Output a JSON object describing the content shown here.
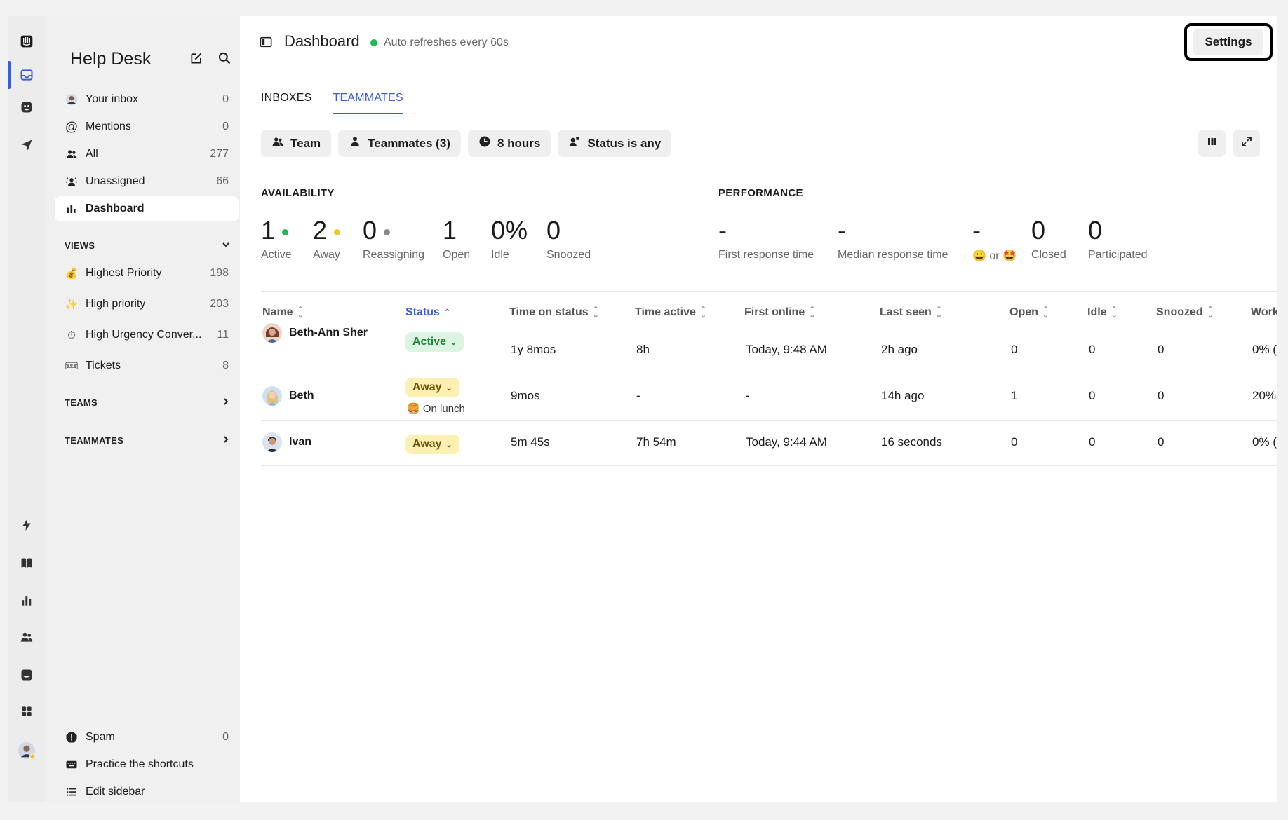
{
  "sidebar": {
    "title": "Help Desk",
    "items": [
      {
        "label": "Your inbox",
        "count": "0",
        "icon": "avatar-icon"
      },
      {
        "label": "Mentions",
        "count": "0",
        "icon": "at-icon"
      },
      {
        "label": "All",
        "count": "277",
        "icon": "people-icon"
      },
      {
        "label": "Unassigned",
        "count": "66",
        "icon": "unassigned-icon"
      },
      {
        "label": "Dashboard",
        "count": "",
        "icon": "bar-chart-icon"
      }
    ],
    "views_label": "VIEWS",
    "views": [
      {
        "label": "Highest Priority",
        "count": "198",
        "emoji": "💰"
      },
      {
        "label": "High priority",
        "count": "203",
        "emoji": "✨"
      },
      {
        "label": "High Urgency Conver...",
        "count": "11",
        "emoji": "⏱"
      },
      {
        "label": "Tickets",
        "count": "8",
        "emoji": "🎟"
      }
    ],
    "teams_label": "TEAMS",
    "teammates_label": "TEAMMATES",
    "bottom": [
      {
        "label": "Spam",
        "count": "0"
      },
      {
        "label": "Practice the shortcuts",
        "count": ""
      },
      {
        "label": "Edit sidebar",
        "count": ""
      }
    ]
  },
  "header": {
    "title": "Dashboard",
    "subtitle": "Auto refreshes every 60s",
    "settings_label": "Settings",
    "status_color": "#1db954"
  },
  "tabs": [
    {
      "label": "INBOXES",
      "active": false
    },
    {
      "label": "TEAMMATES",
      "active": true
    }
  ],
  "filters": [
    {
      "label": "Team",
      "icon": "team-icon"
    },
    {
      "label": "Teammates (3)",
      "icon": "person-icon"
    },
    {
      "label": "8 hours",
      "icon": "clock-icon"
    },
    {
      "label": "Status is any",
      "icon": "status-icon"
    }
  ],
  "availability": {
    "label": "AVAILABILITY",
    "stats": [
      {
        "value": "1",
        "label": "Active",
        "dot": "#1db954"
      },
      {
        "value": "2",
        "label": "Away",
        "dot": "#f5c518"
      },
      {
        "value": "0",
        "label": "Reassigning",
        "dot": "#888888"
      },
      {
        "value": "1",
        "label": "Open",
        "dot": ""
      },
      {
        "value": "0%",
        "label": "Idle",
        "dot": ""
      },
      {
        "value": "0",
        "label": "Snoozed",
        "dot": ""
      }
    ]
  },
  "performance": {
    "label": "PERFORMANCE",
    "stats": [
      {
        "value": "-",
        "label": "First response time"
      },
      {
        "value": "-",
        "label": "Median response time"
      },
      {
        "value": "-",
        "label": "😀 or 🤩"
      },
      {
        "value": "0",
        "label": "Closed"
      },
      {
        "value": "0",
        "label": "Participated"
      }
    ]
  },
  "table": {
    "columns": [
      "Name",
      "Status",
      "Time on status",
      "Time active",
      "First online",
      "Last seen",
      "Open",
      "Idle",
      "Snoozed",
      "Work"
    ],
    "rows": [
      {
        "name": "Beth-Ann Sher",
        "status": "Active",
        "note": "",
        "time_on_status": "1y 8mos",
        "time_active": "8h",
        "first_online": "Today, 9:48 AM",
        "last_seen": "2h ago",
        "open": "0",
        "idle": "0",
        "snoozed": "0",
        "work": "0% ("
      },
      {
        "name": "Beth",
        "status": "Away",
        "note": "🍔 On lunch",
        "time_on_status": "9mos",
        "time_active": "-",
        "first_online": "-",
        "last_seen": "14h ago",
        "open": "1",
        "idle": "0",
        "snoozed": "0",
        "work": "20%"
      },
      {
        "name": "Ivan",
        "status": "Away",
        "note": "",
        "time_on_status": "5m 45s",
        "time_active": "7h 54m",
        "first_online": "Today, 9:44 AM",
        "last_seen": "16 seconds",
        "open": "0",
        "idle": "0",
        "snoozed": "0",
        "work": "0% ("
      }
    ]
  }
}
